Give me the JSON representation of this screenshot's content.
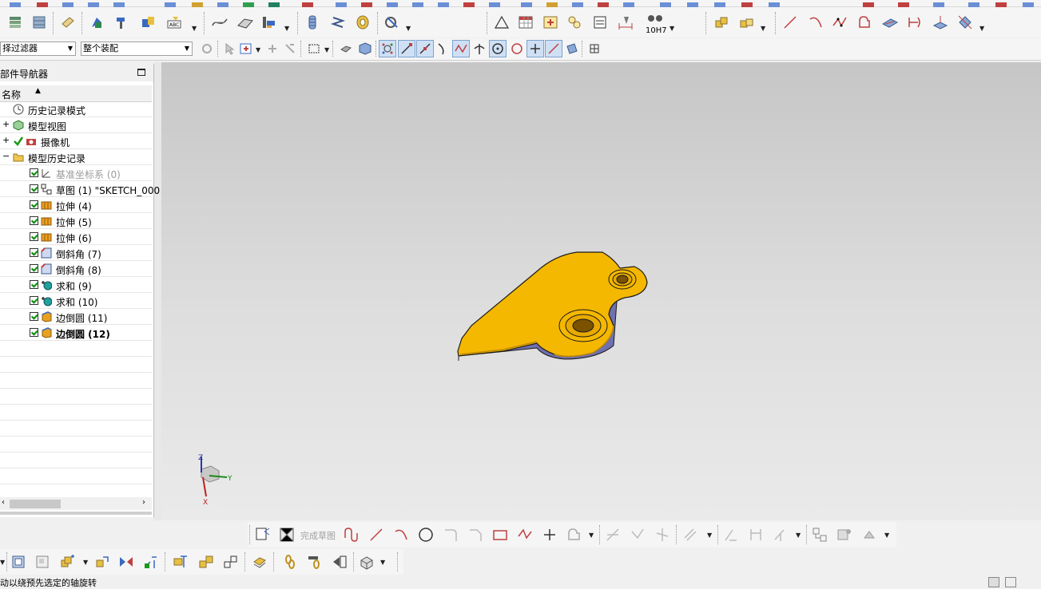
{
  "filters": {
    "type_filter": "择过滤器",
    "scope": "整个装配"
  },
  "navigator": {
    "title": "部件导航器",
    "column_name": "名称",
    "nodes": [
      {
        "label": "历史记录模式",
        "icon": "clock-icon"
      },
      {
        "label": "模型视图",
        "icon": "model-view-icon"
      },
      {
        "label": "摄像机",
        "icon": "camera-icon"
      },
      {
        "label": "模型历史记录",
        "icon": "folder-icon"
      },
      {
        "label": "基准坐标系 (0)",
        "icon": "datum-csys-icon"
      },
      {
        "label": "草图 (1) \"SKETCH_000",
        "icon": "sketch-icon"
      },
      {
        "label": "拉伸 (4)",
        "icon": "extrude-icon"
      },
      {
        "label": "拉伸 (5)",
        "icon": "extrude-icon"
      },
      {
        "label": "拉伸 (6)",
        "icon": "extrude-icon"
      },
      {
        "label": "倒斜角 (7)",
        "icon": "chamfer-icon"
      },
      {
        "label": "倒斜角 (8)",
        "icon": "chamfer-icon"
      },
      {
        "label": "求和 (9)",
        "icon": "unite-icon"
      },
      {
        "label": "求和 (10)",
        "icon": "unite-icon"
      },
      {
        "label": "边倒圆 (11)",
        "icon": "edge-blend-icon"
      },
      {
        "label": "边倒圆 (12)",
        "icon": "edge-blend-icon"
      }
    ]
  },
  "sketch_toolbar": {
    "finish_sketch": "完成草图"
  },
  "toolbar": {
    "tolerance_label": "10H7"
  },
  "triad": {
    "z": "Z",
    "y": "Y",
    "x": "X"
  },
  "status": {
    "message": "动以绕预先选定的轴旋转"
  },
  "colors": {
    "part_face": "#f5b800",
    "part_edge": "#1a1a1a",
    "viewport_top": "#c6c6c6",
    "viewport_bottom": "#eaeaea"
  }
}
